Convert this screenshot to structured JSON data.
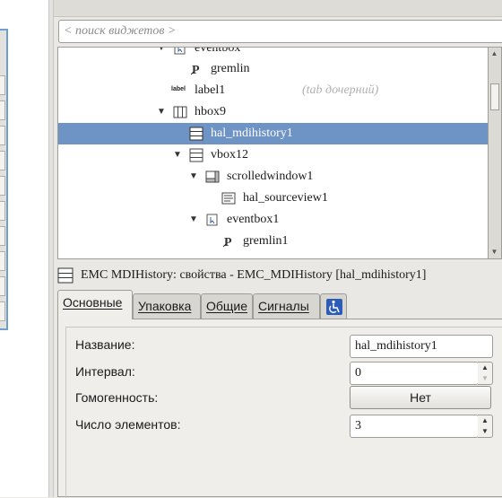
{
  "search": {
    "placeholder": "< поиск виджетов >"
  },
  "tree": {
    "rows": [
      {
        "label": "eventbox",
        "expanded": true,
        "icon": "eventbox-icon"
      },
      {
        "label": "gremlin",
        "icon": "gremlin-icon"
      },
      {
        "label": "label1",
        "icon": "label-icon",
        "icon_text": "label",
        "hint": "(tab дочерний)"
      },
      {
        "label": "hbox9",
        "expanded": true,
        "icon": "hbox-icon"
      },
      {
        "label": "hal_mdihistory1",
        "selected": true,
        "icon": "mdihistory-icon"
      },
      {
        "label": "vbox12",
        "expanded": true,
        "icon": "vbox-icon"
      },
      {
        "label": "scrolledwindow1",
        "expanded": true,
        "icon": "scrolledwindow-icon"
      },
      {
        "label": "hal_sourceview1",
        "icon": "sourceview-icon"
      },
      {
        "label": "eventbox1",
        "expanded": true,
        "icon": "eventbox-icon"
      },
      {
        "label": "gremlin1",
        "icon": "gremlin-icon"
      }
    ]
  },
  "properties": {
    "header": "EMC MDIHistory: свойства - EMC_MDIHistory [hal_mdihistory1]",
    "tabs": [
      {
        "label": "Основные",
        "active": true
      },
      {
        "label": "Упаковка"
      },
      {
        "label": "Общие"
      },
      {
        "label": "Сигналы"
      }
    ],
    "accessibility_tab_icon": "accessibility-icon",
    "rows": {
      "name": {
        "label": "Название:",
        "value": "hal_mdihistory1"
      },
      "interval": {
        "label": "Интервал:",
        "value": "0"
      },
      "homogeneous": {
        "label": "Гомогенность:",
        "value": "Нет"
      },
      "count": {
        "label": "Число элементов:",
        "value": "3"
      }
    }
  }
}
